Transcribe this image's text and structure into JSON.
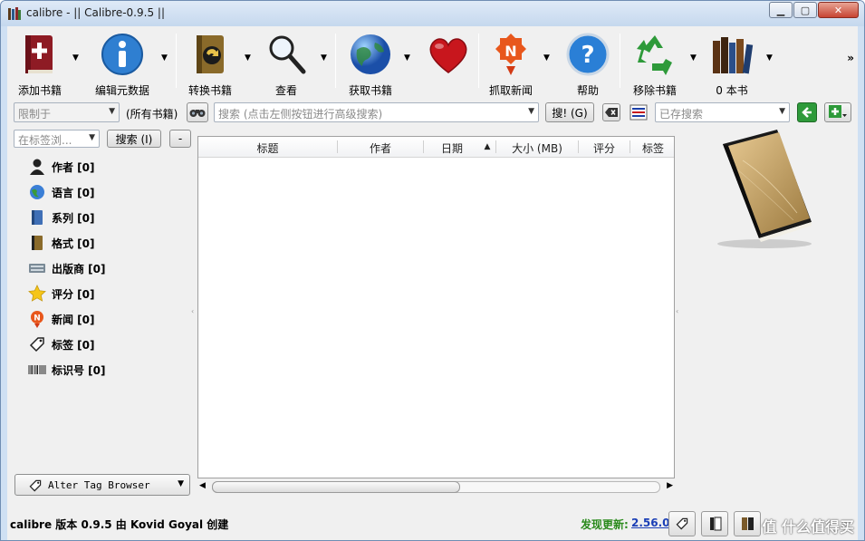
{
  "window": {
    "title": "calibre - || Calibre-0.9.5 ||"
  },
  "toolbar": {
    "items": [
      {
        "label": "添加书籍",
        "icon": "add-book-icon"
      },
      {
        "label": "编辑元数据",
        "icon": "info-icon"
      },
      {
        "label": "转换书籍",
        "icon": "convert-book-icon"
      },
      {
        "label": "查看",
        "icon": "magnifier-icon"
      },
      {
        "label": "获取书籍",
        "icon": "globe-icon"
      },
      {
        "label": "",
        "icon": "heart-icon"
      },
      {
        "label": "抓取新闻",
        "icon": "news-icon"
      },
      {
        "label": "帮助",
        "icon": "help-icon"
      },
      {
        "label": "移除书籍",
        "icon": "recycle-icon"
      },
      {
        "label": "0 本书",
        "icon": "library-icon"
      }
    ],
    "more": "»"
  },
  "search_bar": {
    "restrict_placeholder": "限制于",
    "all_books": "(所有书籍)",
    "search_placeholder": "搜索 (点击左侧按钮进行高级搜索)",
    "search_button": "搜! (G)",
    "saved_search_placeholder": "已存搜索"
  },
  "tag_browser": {
    "find_placeholder": "在标签浏...",
    "find_button": "搜索 (I)",
    "collapse_button": "-",
    "categories": [
      {
        "label": "作者 [0]",
        "icon": "person-icon"
      },
      {
        "label": "语言 [0]",
        "icon": "languages-icon"
      },
      {
        "label": "系列 [0]",
        "icon": "series-icon"
      },
      {
        "label": "格式 [0]",
        "icon": "format-icon"
      },
      {
        "label": "出版商 [0]",
        "icon": "publisher-icon"
      },
      {
        "label": "评分 [0]",
        "icon": "star-icon"
      },
      {
        "label": "新闻 [0]",
        "icon": "news-icon"
      },
      {
        "label": "标签 [0]",
        "icon": "tag-icon"
      },
      {
        "label": "标识号 [0]",
        "icon": "barcode-icon"
      }
    ],
    "alter_button": "Alter Tag Browser"
  },
  "book_list": {
    "columns": [
      "标题",
      "作者",
      "日期",
      "大小 (MB)",
      "评分",
      "标签"
    ],
    "sort_indicator": "▲",
    "rows": []
  },
  "status": {
    "left": "calibre 版本 0.9.5 由 Kovid Goyal 创建",
    "update_label": "发现更新:",
    "update_version": "2.56.0",
    "watermark": "值 什么值得买"
  },
  "colors": {
    "title_bar": "#cfe0f3",
    "update_green": "#2a8a1c",
    "link_blue": "#1b3fb6",
    "close_red": "#c74432"
  }
}
